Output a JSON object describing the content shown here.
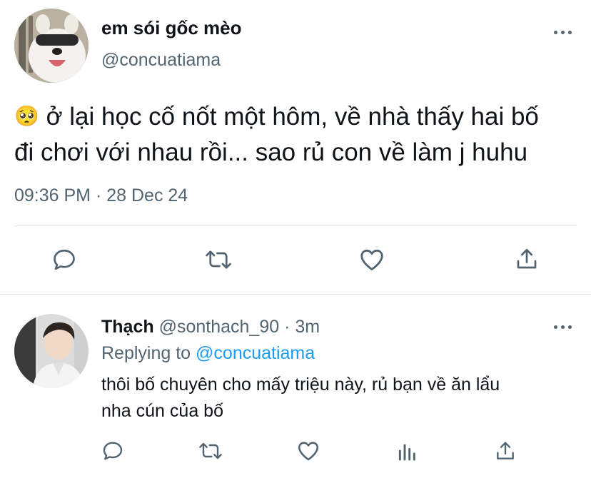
{
  "tweet": {
    "author_name": "em sói gốc mèo",
    "author_handle": "@concuatiama",
    "emoji": "🥺",
    "text_line1": "ở lại học cố nốt một hôm, về nhà thấy hai bố",
    "text_line2": "đi chơi với nhau rồi... sao rủ con về làm j huhu",
    "time": "09:36 PM",
    "separator": "·",
    "date": "28 Dec 24",
    "actions": [
      "reply-icon",
      "retweet-icon",
      "like-icon",
      "share-icon"
    ]
  },
  "reply": {
    "author_name": "Thạch",
    "author_handle": "@sonthach_90",
    "separator": "·",
    "age": "3m",
    "replying_prefix": "Replying to",
    "replying_handle": "@concuatiama",
    "text_line1": "thôi bố chuyên cho mấy triệu này, rủ bạn về ăn lẩu",
    "text_line2": "nha cún của bố",
    "actions": [
      "reply-icon",
      "retweet-icon",
      "like-icon",
      "analytics-icon",
      "share-icon"
    ]
  },
  "colors": {
    "text": "#0f1419",
    "secondary": "#536471",
    "link": "#1d9bf0",
    "divider": "#e1e6ea"
  }
}
